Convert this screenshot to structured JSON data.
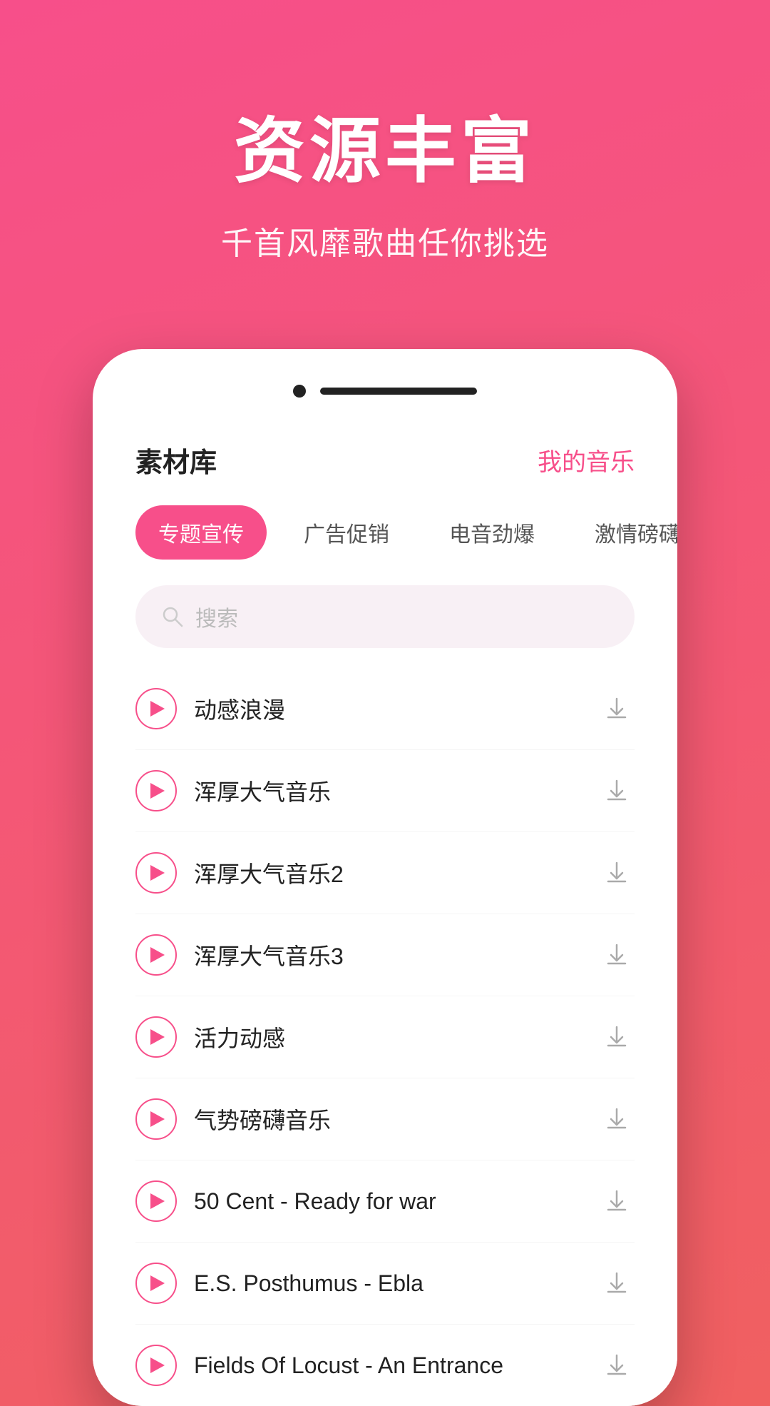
{
  "header": {
    "main_title": "资源丰富",
    "sub_title": "千首风靡歌曲任你挑选"
  },
  "phone": {
    "top_bar": {
      "library_label": "素材库",
      "my_music_label": "我的音乐"
    },
    "tabs": [
      {
        "id": "tab1",
        "label": "专题宣传",
        "active": true
      },
      {
        "id": "tab2",
        "label": "广告促销",
        "active": false
      },
      {
        "id": "tab3",
        "label": "电音劲爆",
        "active": false
      },
      {
        "id": "tab4",
        "label": "激情磅礴",
        "active": false
      }
    ],
    "search": {
      "placeholder": "搜索"
    },
    "songs": [
      {
        "id": 1,
        "name": "动感浪漫"
      },
      {
        "id": 2,
        "name": "浑厚大气音乐"
      },
      {
        "id": 3,
        "name": "浑厚大气音乐2"
      },
      {
        "id": 4,
        "name": "浑厚大气音乐3"
      },
      {
        "id": 5,
        "name": "活力动感"
      },
      {
        "id": 6,
        "name": "气势磅礴音乐"
      },
      {
        "id": 7,
        "name": "50 Cent - Ready for war"
      },
      {
        "id": 8,
        "name": "E.S. Posthumus - Ebla"
      },
      {
        "id": 9,
        "name": "Fields Of Locust - An Entrance"
      }
    ]
  },
  "colors": {
    "primary": "#f74f8a",
    "text_dark": "#222222",
    "text_muted": "#bbbbbb",
    "bg_search": "#f8f0f5"
  }
}
